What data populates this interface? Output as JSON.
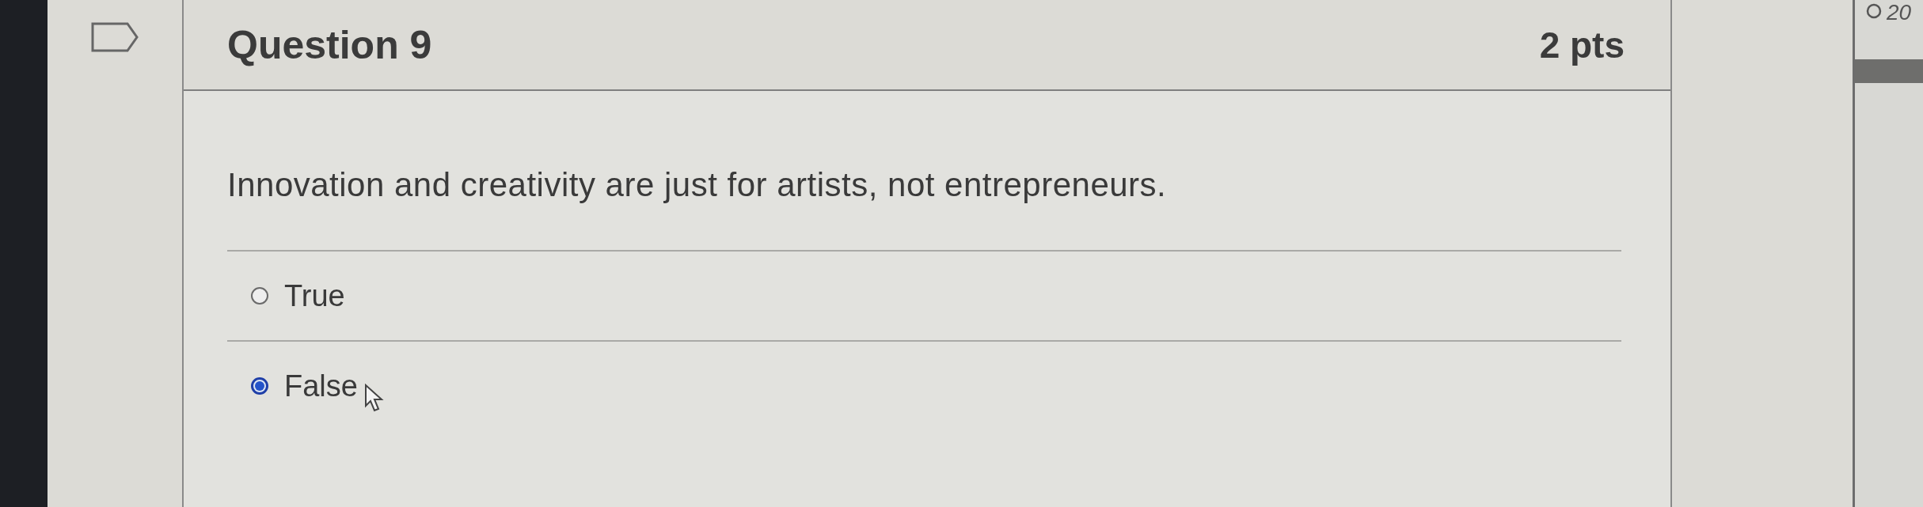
{
  "question": {
    "title": "Question 9",
    "points": "2 pts",
    "prompt": "Innovation and creativity are just for artists, not entrepreneurs.",
    "answers": [
      {
        "label": "True",
        "selected": false
      },
      {
        "label": "False",
        "selected": true
      }
    ]
  },
  "side_note": "20"
}
